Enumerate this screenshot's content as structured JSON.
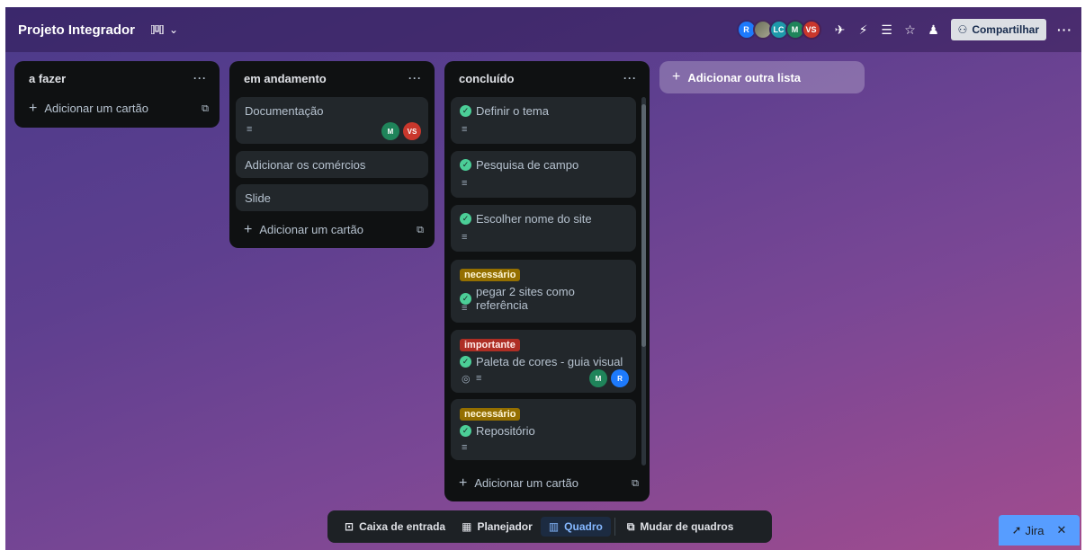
{
  "header": {
    "title": "Projeto Integrador",
    "view_icon": "board-view-icon",
    "avatars": [
      {
        "initials": "R",
        "color": "#1d7afc"
      },
      {
        "initials": "",
        "color": "#8c8f7a"
      },
      {
        "initials": "LC",
        "color": "#1d9aaa"
      },
      {
        "initials": "M",
        "color": "#1f845a"
      },
      {
        "initials": "VS",
        "color": "#c9372c"
      }
    ],
    "share_label": "Compartilhar"
  },
  "lists": [
    {
      "title": "a fazer",
      "add_card_label": "Adicionar um cartão",
      "cards": []
    },
    {
      "title": "em andamento",
      "add_card_label": "Adicionar um cartão",
      "cards": [
        {
          "title": "Documentação",
          "members": [
            "M",
            "VS"
          ]
        },
        {
          "title": "Adicionar os comércios"
        },
        {
          "title": "Slide"
        }
      ]
    },
    {
      "title": "concluído",
      "add_card_label": "Adicionar um cartão",
      "cards": [
        {
          "title": "Definir o tema"
        },
        {
          "title": "Pesquisa de campo"
        },
        {
          "title": "Escolher nome do site"
        },
        {
          "label": "necessário",
          "title": "pegar 2 sites como referência"
        },
        {
          "label": "importante",
          "title": "Paleta de cores - guia visual",
          "members": [
            "M",
            "R"
          ]
        },
        {
          "label": "necessário",
          "title": "Repositório"
        }
      ]
    }
  ],
  "add_list_label": "Adicionar outra lista",
  "bottom_bar": {
    "inbox": "Caixa de entrada",
    "planner": "Planejador",
    "board": "Quadro",
    "switch": "Mudar de quadros"
  },
  "jira": {
    "label": "Jira"
  }
}
